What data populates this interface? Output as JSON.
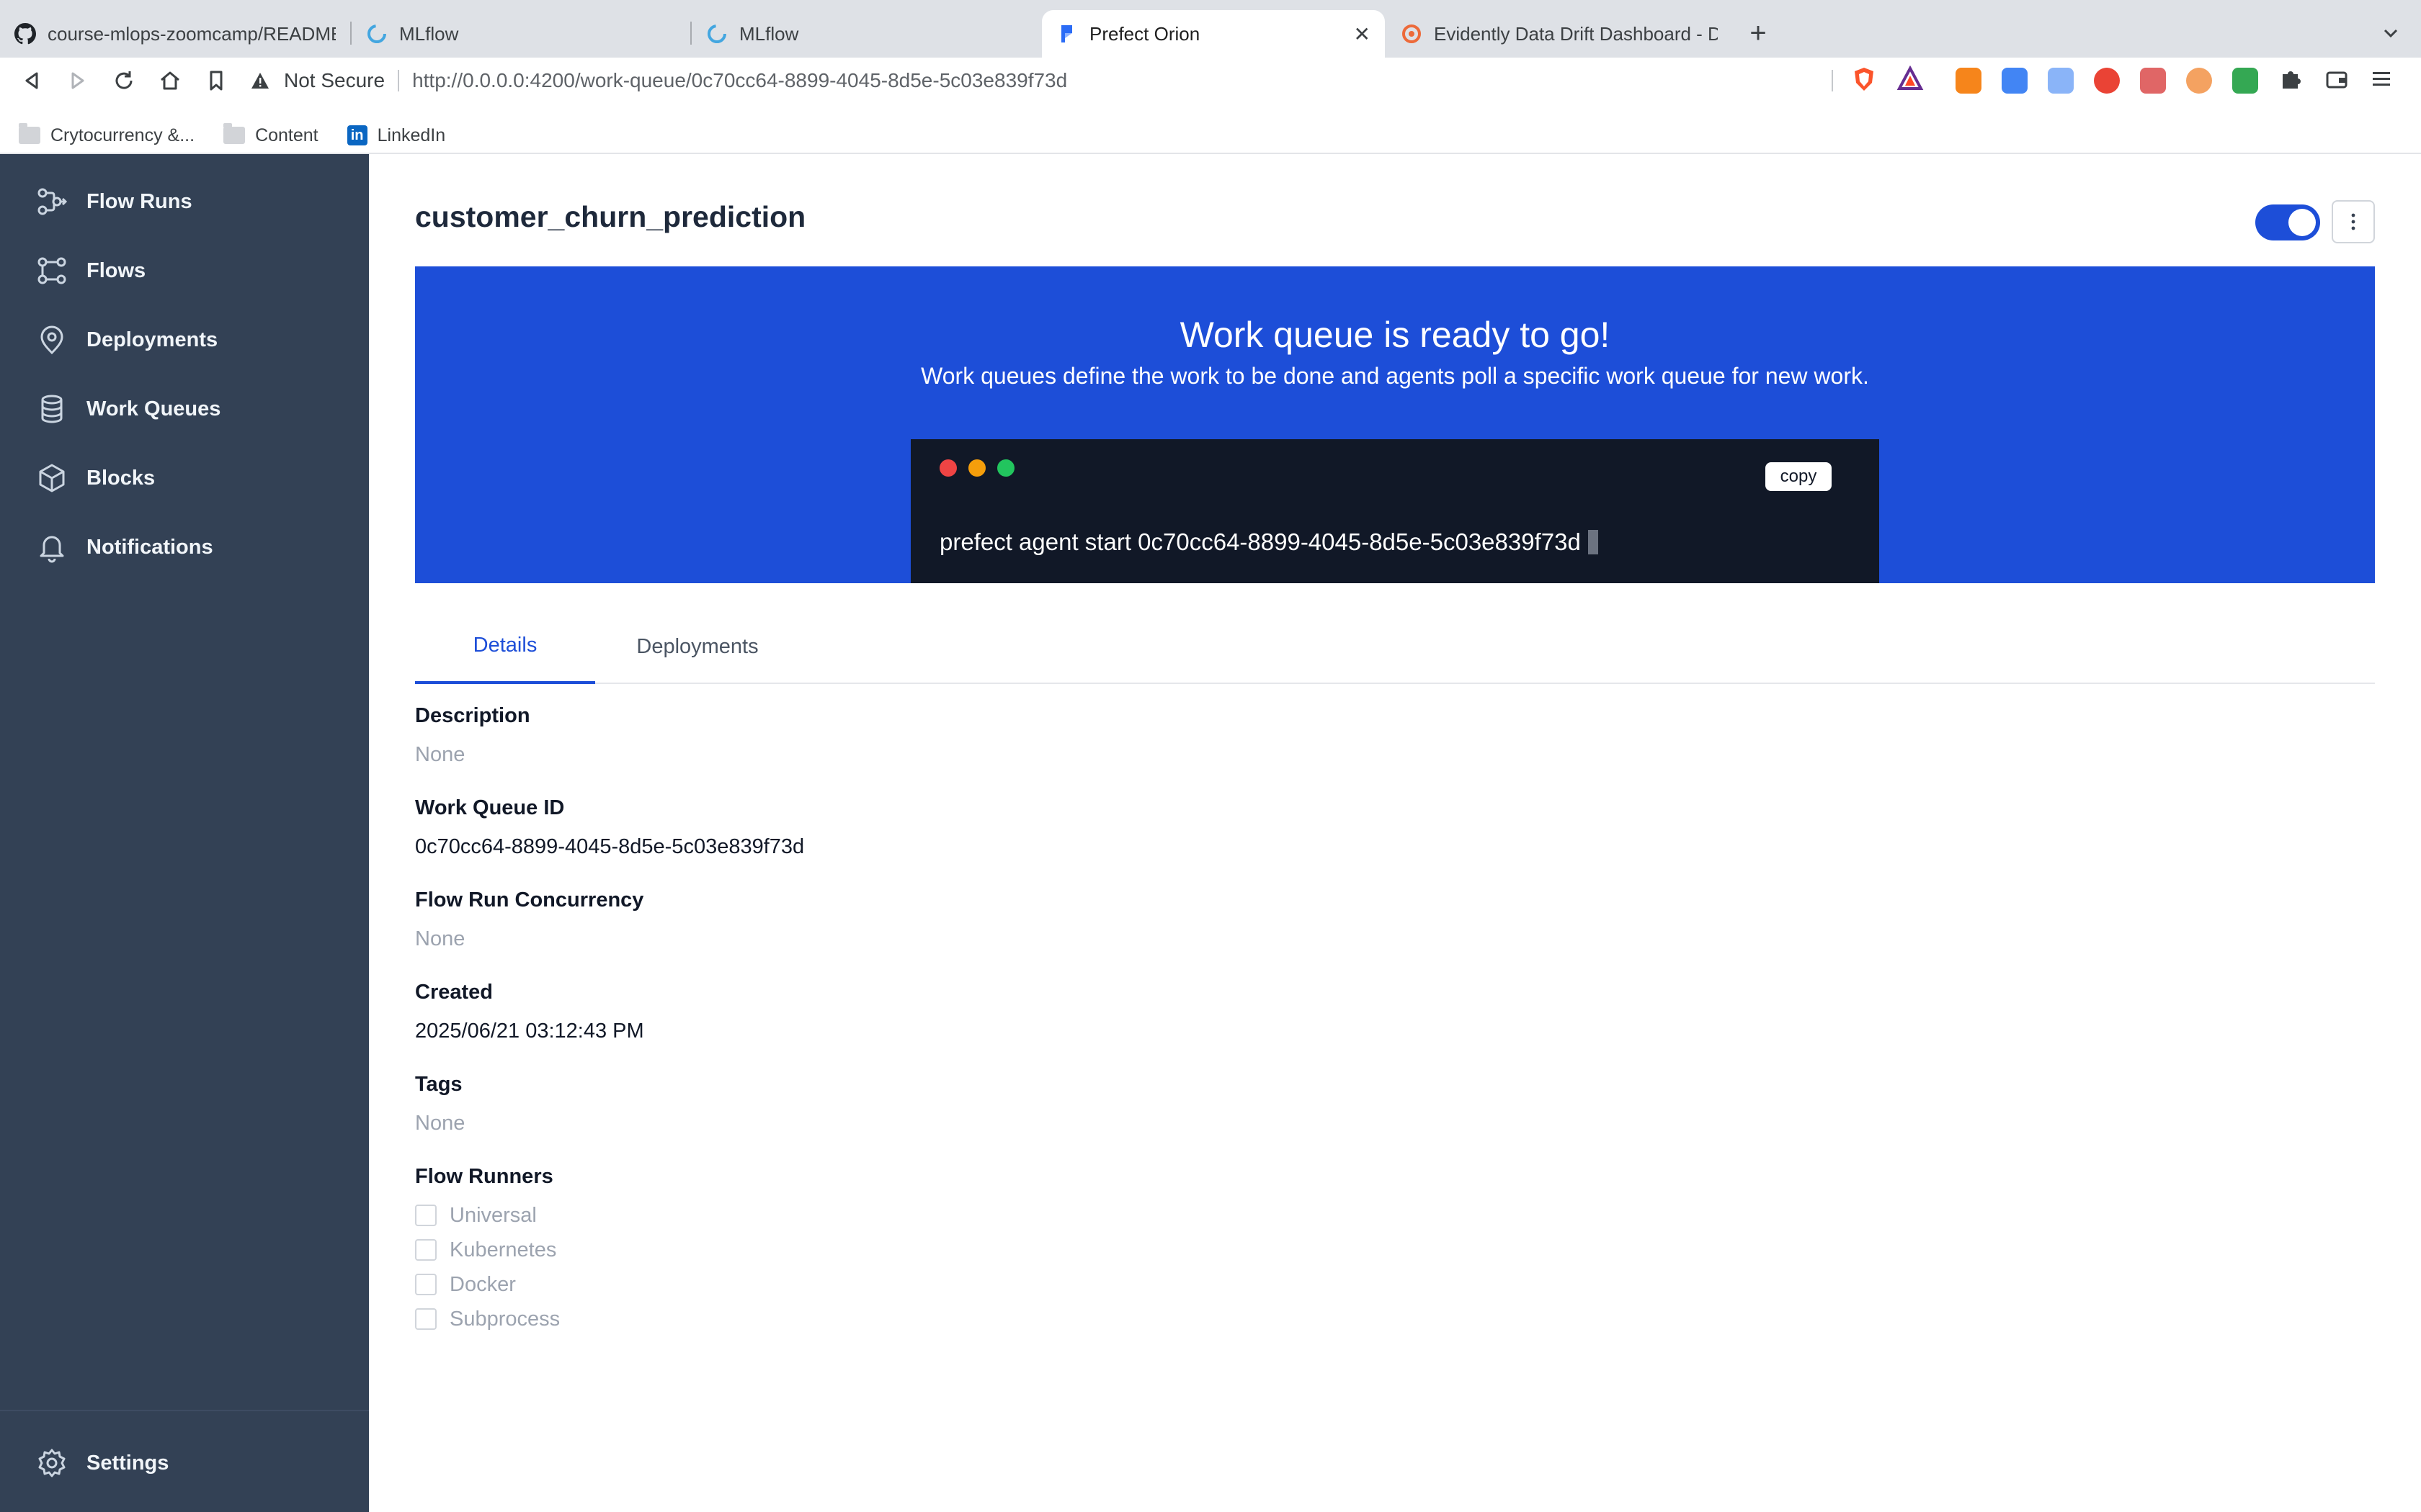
{
  "browser": {
    "tabs": [
      {
        "title": "course-mlops-zoomcamp/README",
        "icon": "github-icon",
        "active": false
      },
      {
        "title": "MLflow",
        "icon": "mlflow-icon",
        "active": false
      },
      {
        "title": "MLflow",
        "icon": "mlflow-icon",
        "active": false
      },
      {
        "title": "Prefect Orion",
        "icon": "prefect-icon",
        "active": true
      },
      {
        "title": "Evidently Data Drift Dashboard - Da",
        "icon": "evidently-icon",
        "active": false
      }
    ],
    "new_tab_label": "+",
    "security_label": "Not Secure",
    "url": "http://0.0.0.0:4200/work-queue/0c70cc64-8899-4045-8d5e-5c03e839f73d",
    "bookmarks": [
      {
        "label": "Crytocurrency &...",
        "icon": "folder-icon"
      },
      {
        "label": "Content",
        "icon": "folder-icon"
      },
      {
        "label": "LinkedIn",
        "icon": "linkedin-icon"
      }
    ],
    "extension_colors": [
      "#f6851b",
      "#4285f4",
      "#8ab4f8",
      "#ea4335",
      "#e06666",
      "#f4a261",
      "#34a853"
    ]
  },
  "sidebar": {
    "items": [
      {
        "label": "Flow Runs",
        "icon": "flow-runs-icon"
      },
      {
        "label": "Flows",
        "icon": "flows-icon"
      },
      {
        "label": "Deployments",
        "icon": "map-pin-icon"
      },
      {
        "label": "Work Queues",
        "icon": "database-icon"
      },
      {
        "label": "Blocks",
        "icon": "cube-icon"
      },
      {
        "label": "Notifications",
        "icon": "bell-icon"
      }
    ],
    "settings_label": "Settings"
  },
  "page": {
    "title": "customer_churn_prediction",
    "queue_active": true
  },
  "banner": {
    "title": "Work queue is ready to go!",
    "subtitle": "Work queues define the work to be done and agents poll a specific work queue for new work.",
    "copy_label": "copy",
    "command": "prefect agent start 0c70cc64-8899-4045-8d5e-5c03e839f73d"
  },
  "tabs": [
    "Details",
    "Deployments"
  ],
  "details": {
    "description_label": "Description",
    "description_value": "None",
    "work_queue_id_label": "Work Queue ID",
    "work_queue_id_value": "0c70cc64-8899-4045-8d5e-5c03e839f73d",
    "concurrency_label": "Flow Run Concurrency",
    "concurrency_value": "None",
    "created_label": "Created",
    "created_value": "2025/06/21 03:12:43 PM",
    "tags_label": "Tags",
    "tags_value": "None",
    "flow_runners_label": "Flow Runners",
    "flow_runners": [
      "Universal",
      "Kubernetes",
      "Docker",
      "Subprocess"
    ]
  },
  "colors": {
    "sidebar_bg": "#334155",
    "accent": "#1d4ed8",
    "terminal_bg": "#111827",
    "terminal_dots": [
      "#ef4444",
      "#f59e0b",
      "#22c55e"
    ]
  }
}
